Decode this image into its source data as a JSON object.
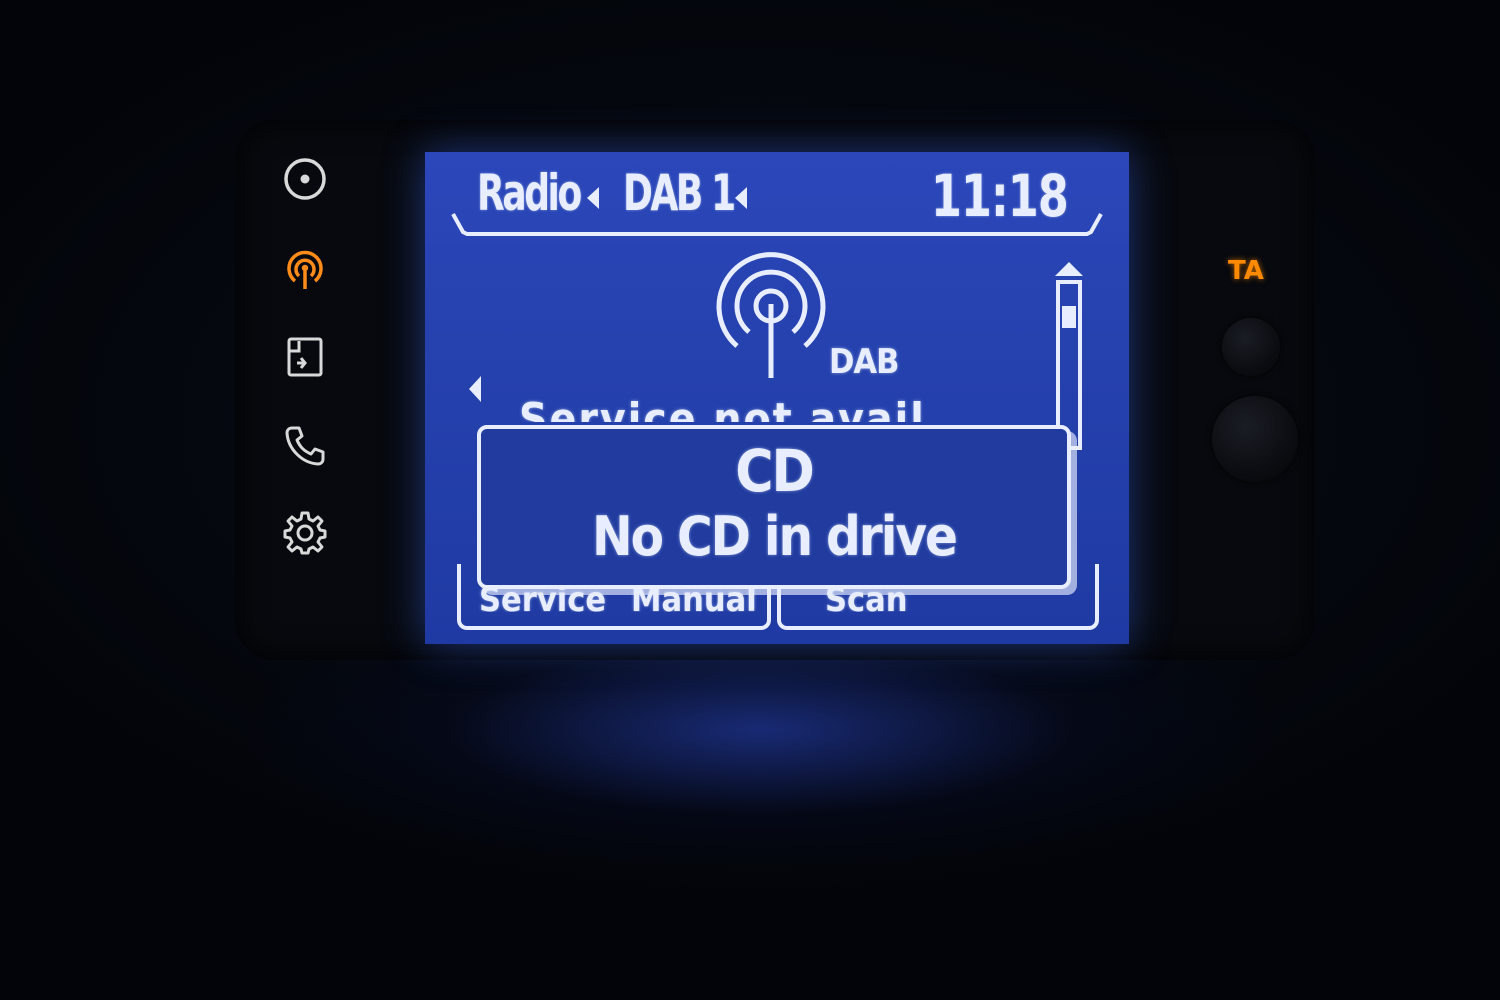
{
  "screen": {
    "source_label": "Radio",
    "band_label": "DAB 1",
    "clock": "11:18",
    "dab_logo_label": "DAB",
    "station_text_partial": "Service not avail",
    "popup": {
      "title": "CD",
      "message": "No CD in drive"
    },
    "softkeys": [
      {
        "label": "Service"
      },
      {
        "label": "Manual"
      },
      {
        "label": "Scan"
      }
    ]
  },
  "side_buttons": [
    {
      "icon": "cd-icon",
      "color": "#d9d9d9"
    },
    {
      "icon": "radio-icon",
      "color": "#ff8c1a",
      "active": true
    },
    {
      "icon": "media-source-icon",
      "color": "#d9d9d9"
    },
    {
      "icon": "phone-icon",
      "color": "#d9d9d9"
    },
    {
      "icon": "settings-icon",
      "color": "#d9d9d9"
    }
  ],
  "indicators": {
    "ta_label": "TA",
    "ta_color": "#ff8a00"
  },
  "colors": {
    "lcd_background": "#2541ad",
    "lcd_foreground": "#e8eeff",
    "active_accent": "#ff8c1a"
  }
}
